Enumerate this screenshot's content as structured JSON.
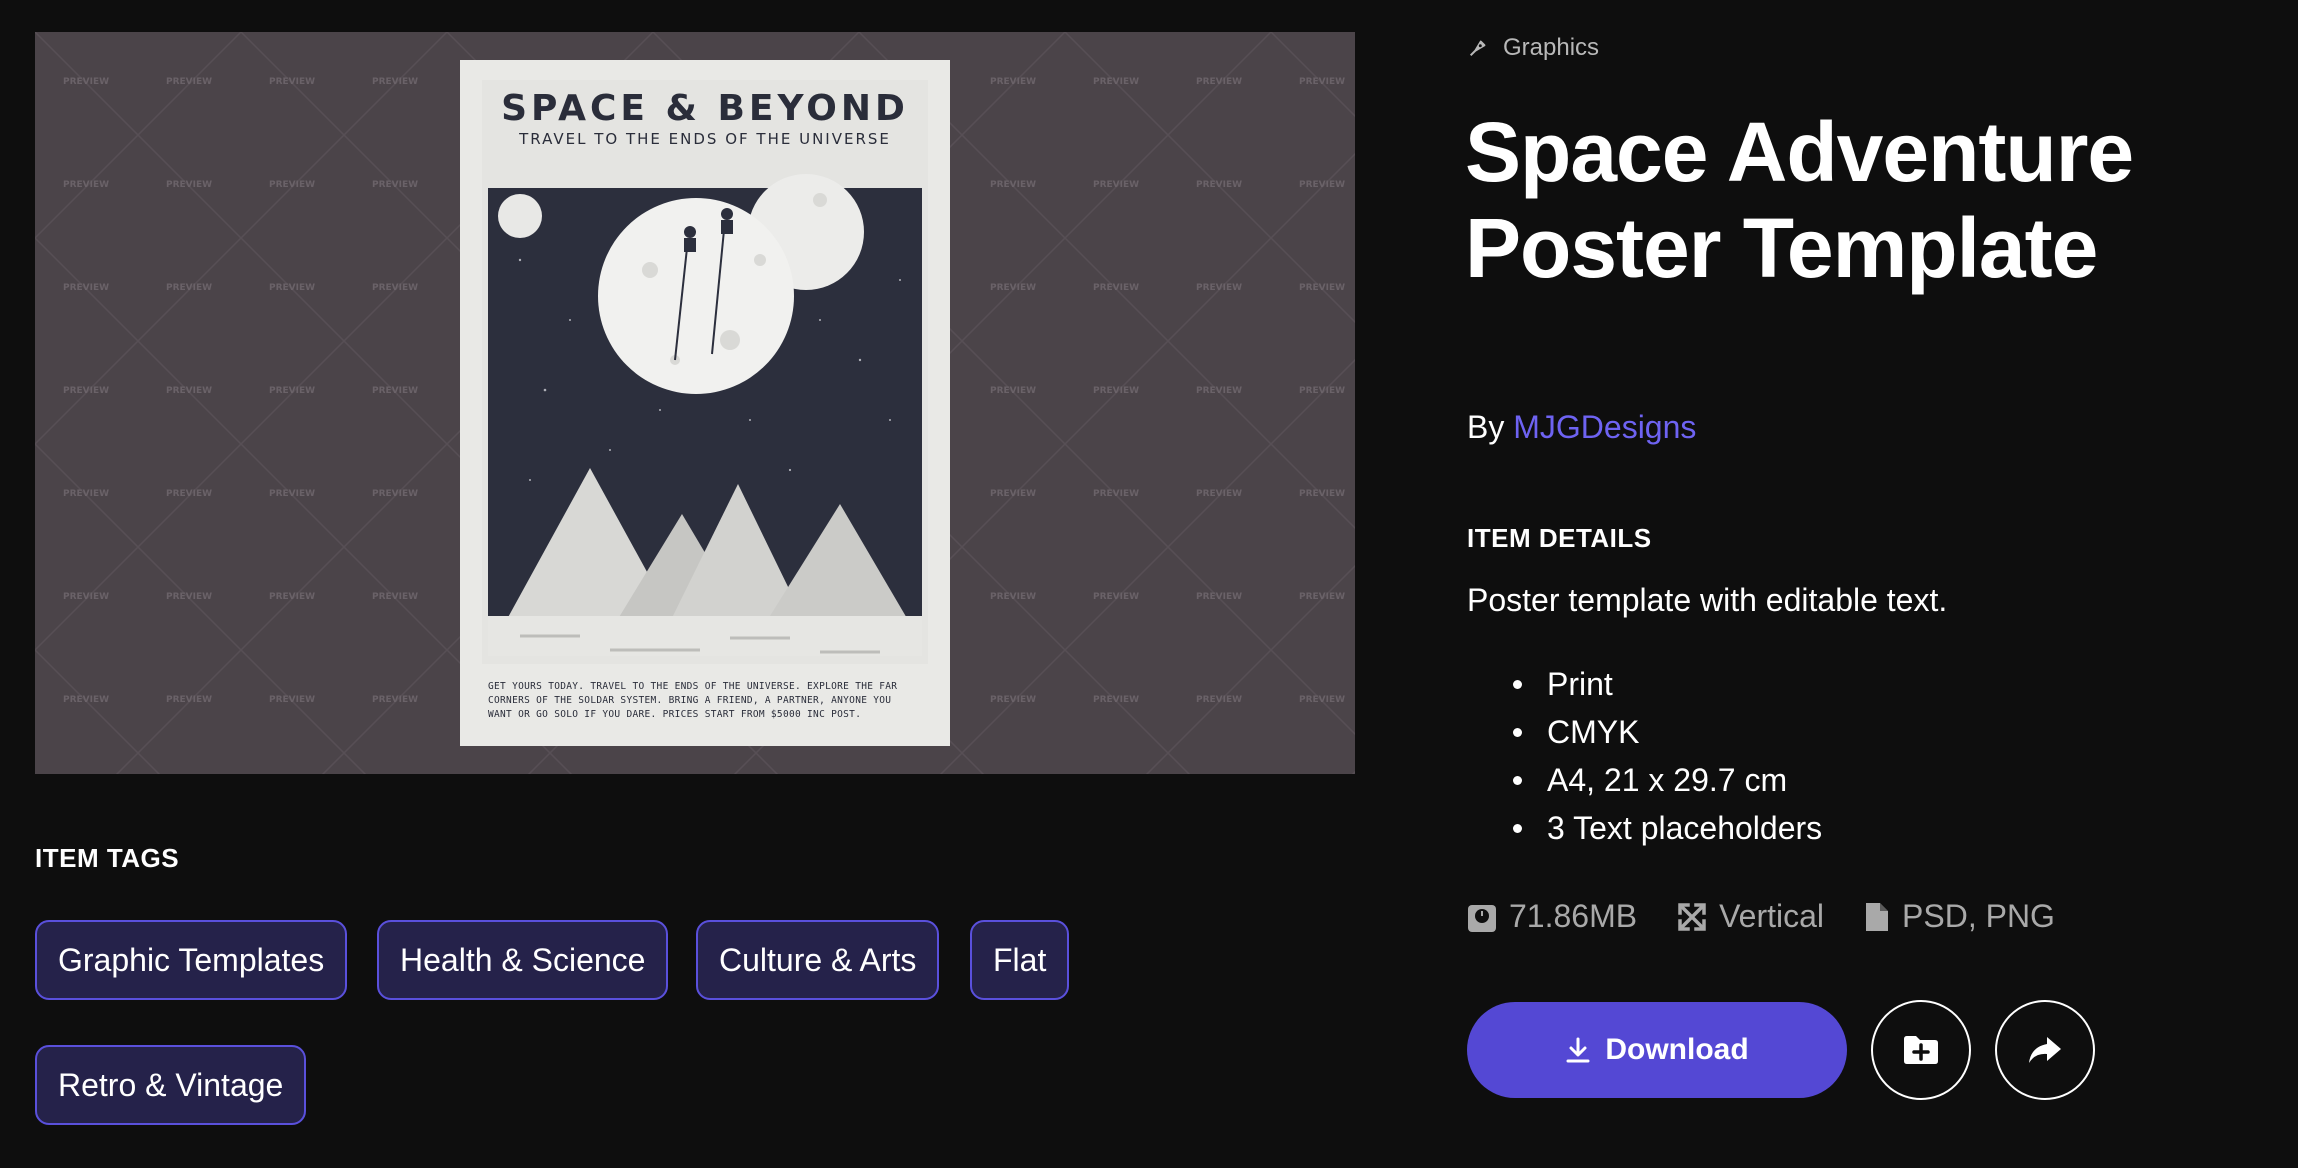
{
  "preview": {
    "watermark_text": "PREVIEW",
    "poster": {
      "title": "SPACE & BEYOND",
      "subtitle": "TRAVEL TO THE ENDS OF THE UNIVERSE",
      "footer_lines": [
        "GET YOURS TODAY. TRAVEL TO THE ENDS OF THE UNIVERSE. EXPLORE THE FAR",
        "CORNERS OF THE SOLDAR SYSTEM. BRING A FRIEND, A PARTNER, ANYONE YOU",
        "WANT OR GO SOLO IF YOU DARE. PRICES START FROM $5000 INC POST."
      ]
    }
  },
  "tags": {
    "heading": "ITEM TAGS",
    "items": [
      "Graphic Templates",
      "Health & Science",
      "Culture & Arts",
      "Flat",
      "Retro & Vintage"
    ]
  },
  "item": {
    "category": "Graphics",
    "category_icon": "pen-nib-icon",
    "title": "Space Adventure Poster Template",
    "by_label": "By",
    "author": "MJGDesigns"
  },
  "details": {
    "heading": "ITEM DETAILS",
    "description": "Poster template with editable text.",
    "features": [
      "Print",
      "CMYK",
      "A4, 21 x 29.7 cm",
      "3 Text placeholders"
    ]
  },
  "meta": {
    "size": "71.86MB",
    "orientation": "Vertical",
    "formats": "PSD, PNG"
  },
  "actions": {
    "download_label": "Download",
    "add_to_collection_icon": "folder-plus-icon",
    "share_icon": "share-arrow-icon"
  },
  "colors": {
    "background": "#0e0e0e",
    "accent": "#5448d4",
    "author_link": "#6e63f2",
    "tag_fill": "#25224a",
    "tag_border": "#5a50dc",
    "preview_bg": "#4b4449"
  }
}
